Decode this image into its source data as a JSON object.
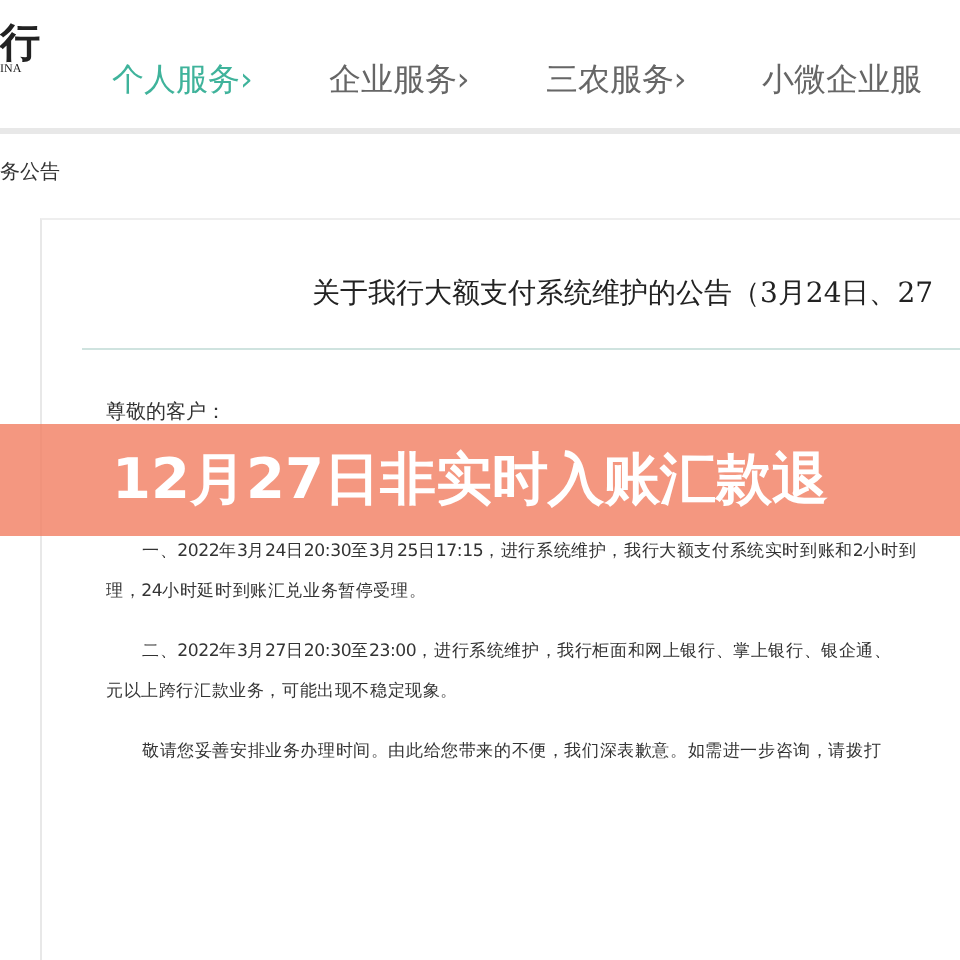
{
  "logo": {
    "mark": "行",
    "subtitle": "INA"
  },
  "nav": [
    {
      "label": "个人服务",
      "chevron": "›",
      "selected": true
    },
    {
      "label": "企业服务",
      "chevron": "›",
      "selected": false
    },
    {
      "label": "三农服务",
      "chevron": "›",
      "selected": false
    },
    {
      "label": "小微企业服",
      "selected": false
    }
  ],
  "breadcrumb": "务公告",
  "notice": {
    "title": "关于我行大额支付系统维护的公告（3月24日、27",
    "greeting": "尊敬的客户：",
    "lines": [
      {
        "text": "一、2022年3月24日20:30至3月25日17:15，进行系统维护，我行大额支付系统实时到账和2小时到",
        "indent": true
      },
      {
        "text": "理，24小时延时到账汇兑业务暂停受理。",
        "indent": false
      },
      {
        "text": "二、2022年3月27日20:30至23:00，进行系统维护，我行柜面和网上银行、掌上银行、银企通、",
        "indent": true
      },
      {
        "text": "元以上跨行汇款业务，可能出现不稳定现象。",
        "indent": false
      },
      {
        "text": "敬请您妥善安排业务办理时间。由此给您带来的不便，我们深表歉意。如需进一步咨询，请拨打",
        "indent": true
      }
    ]
  },
  "banner": "12月27日非实时入账汇款退"
}
